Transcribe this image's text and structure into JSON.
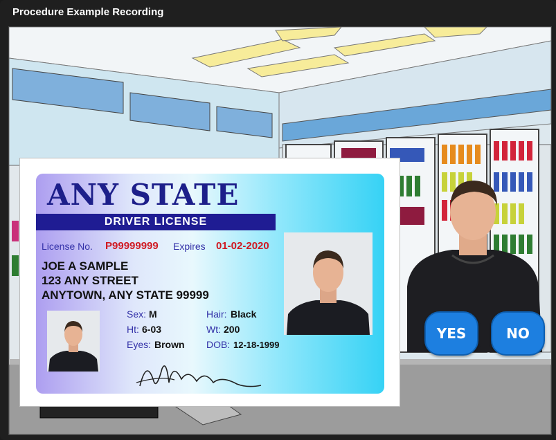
{
  "window": {
    "title": "Procedure Example Recording"
  },
  "buttons": {
    "yes": "YES",
    "no": "NO"
  },
  "license": {
    "state": "ANY STATE",
    "type": "DRIVER LICENSE",
    "license_no_label": "License No.",
    "license_no": "P99999999",
    "expires_label": "Expires",
    "expires": "01-02-2020",
    "name": "JOE A SAMPLE",
    "street": "123 ANY STREET",
    "city": "ANYTOWN, ANY STATE 99999",
    "sex_label": "Sex:",
    "sex": "M",
    "hair_label": "Hair:",
    "hair": "Black",
    "height_label": "Ht:",
    "height": "6-03",
    "weight_label": "Wt:",
    "weight": "200",
    "eyes_label": "Eyes:",
    "eyes": "Brown",
    "dob_label": "DOB:",
    "dob": "12-18-1999"
  },
  "colors": {
    "button_blue": "#1d7fe0",
    "license_navy": "#1f1c93",
    "license_red": "#d01a22"
  }
}
